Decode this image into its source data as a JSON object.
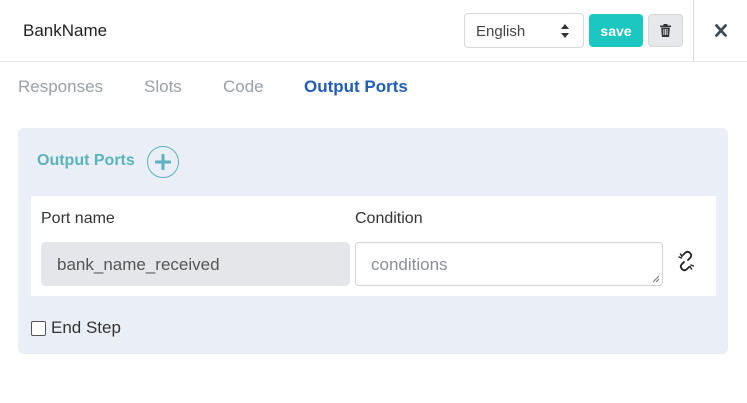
{
  "header": {
    "title": "BankName",
    "language_selected": "English",
    "save_label": "save"
  },
  "icons": {
    "select_arrows": "sort-arrows-icon",
    "delete": "trash-icon",
    "close": "close-x-icon",
    "add": "plus-icon",
    "unlink": "unlink-chain-icon"
  },
  "tabs": [
    {
      "label": "Responses",
      "active": false
    },
    {
      "label": "Slots",
      "active": false
    },
    {
      "label": "Code",
      "active": false
    },
    {
      "label": "Output Ports",
      "active": true
    }
  ],
  "output_ports": {
    "title": "Output Ports",
    "columns": {
      "port_name": "Port name",
      "condition": "Condition"
    },
    "rows": [
      {
        "port_name": "bank_name_received",
        "condition": "",
        "condition_placeholder": "conditions"
      }
    ]
  },
  "end_step": {
    "label": "End Step",
    "checked": false
  },
  "colors": {
    "accent_teal": "#1cc7c2",
    "active_tab": "#1f5db8",
    "panel_title": "#5ab3bd",
    "panel_bg": "#eaeef6"
  }
}
